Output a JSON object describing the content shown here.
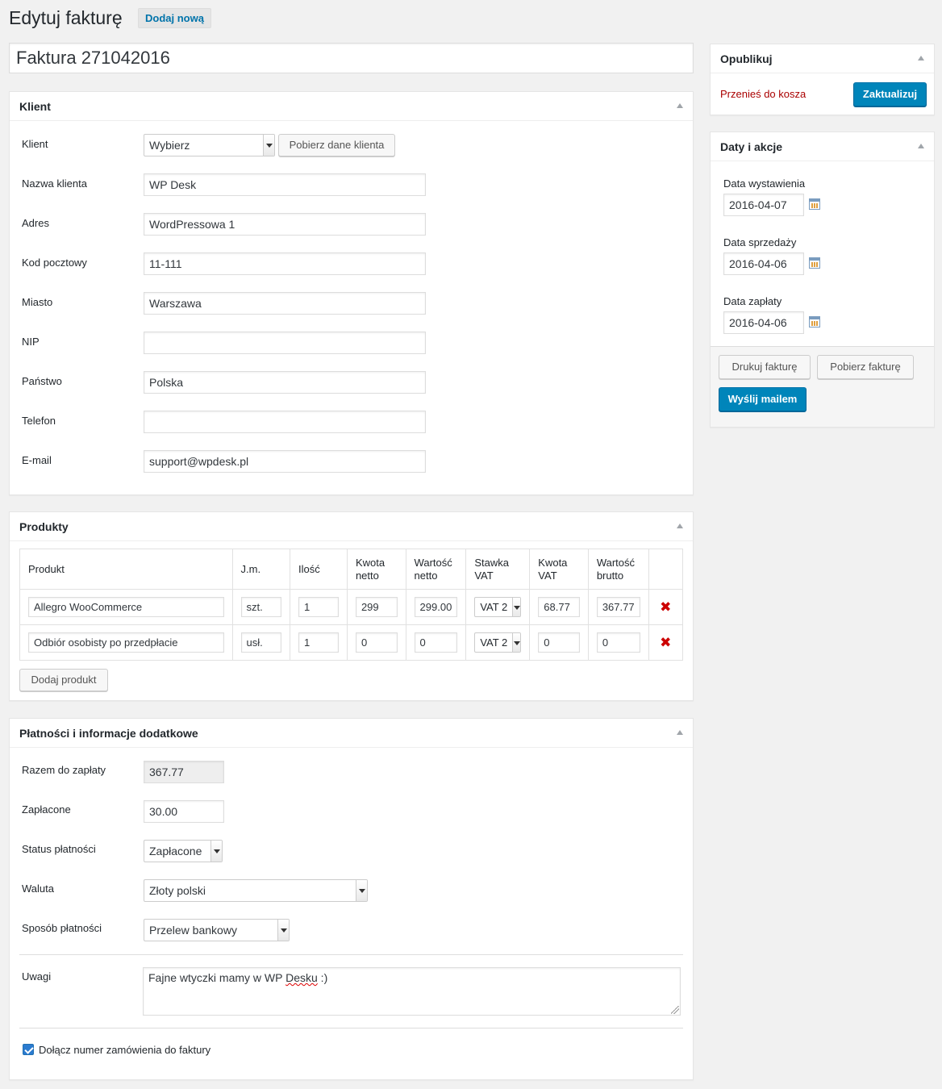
{
  "header": {
    "title": "Edytuj fakturę",
    "add_new": "Dodaj nową"
  },
  "invoice_title": "Faktura 271042016",
  "client": {
    "heading": "Klient",
    "client_label": "Klient",
    "client_select": "Wybierz",
    "fetch_button": "Pobierz dane klienta",
    "fields": [
      {
        "label": "Nazwa klienta",
        "value": "WP Desk"
      },
      {
        "label": "Adres",
        "value": "WordPressowa 1"
      },
      {
        "label": "Kod pocztowy",
        "value": "11-111"
      },
      {
        "label": "Miasto",
        "value": "Warszawa"
      },
      {
        "label": "NIP",
        "value": ""
      },
      {
        "label": "Państwo",
        "value": "Polska"
      },
      {
        "label": "Telefon",
        "value": ""
      },
      {
        "label": "E-mail",
        "value": "support@wpdesk.pl"
      }
    ]
  },
  "products": {
    "heading": "Produkty",
    "columns": [
      "Produkt",
      "J.m.",
      "Ilość",
      "Kwota netto",
      "Wartość netto",
      "Stawka VAT",
      "Kwota VAT",
      "Wartość brutto"
    ],
    "rows": [
      {
        "name": "Allegro WooCommerce",
        "unit": "szt.",
        "qty": "1",
        "net_price": "299",
        "net_value": "299.00",
        "vat_rate": "VAT 2",
        "vat_amount": "68.77",
        "gross": "367.77"
      },
      {
        "name": "Odbiór osobisty po przedpłacie",
        "unit": "usł.",
        "qty": "1",
        "net_price": "0",
        "net_value": "0",
        "vat_rate": "VAT 2",
        "vat_amount": "0",
        "gross": "0"
      }
    ],
    "delete_symbol": "✖",
    "add_button": "Dodaj produkt"
  },
  "payments": {
    "heading": "Płatności i informacje dodatkowe",
    "total_label": "Razem do zapłaty",
    "total_value": "367.77",
    "paid_label": "Zapłacone",
    "paid_value": "30.00",
    "status_label": "Status płatności",
    "status_value": "Zapłacone",
    "currency_label": "Waluta",
    "currency_value": "Złoty polski",
    "method_label": "Sposób płatności",
    "method_value": "Przelew bankowy",
    "notes_label": "Uwagi",
    "notes_before": "Fajne wtyczki mamy w WP ",
    "notes_misspelled": "Desku",
    "notes_after": " :)",
    "attach_label": "Dołącz numer zamówienia do faktury"
  },
  "publish": {
    "heading": "Opublikuj",
    "trash": "Przenieś do kosza",
    "update": "Zaktualizuj"
  },
  "dates": {
    "heading": "Daty i akcje",
    "issue_label": "Data wystawienia",
    "issue_value": "2016-04-07",
    "sale_label": "Data sprzedaży",
    "sale_value": "2016-04-06",
    "payment_label": "Data zapłaty",
    "payment_value": "2016-04-06",
    "print": "Drukuj fakturę",
    "download": "Pobierz fakturę",
    "email": "Wyślij mailem"
  },
  "colors": {
    "primary": "#0085ba",
    "link": "#0073aa",
    "danger": "#a00"
  }
}
